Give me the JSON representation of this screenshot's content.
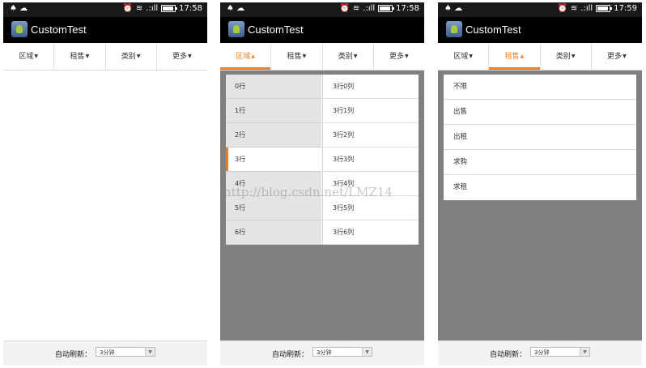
{
  "app": {
    "title": "CustomTest"
  },
  "status": {
    "times": [
      "17:58",
      "17:58",
      "17:59"
    ],
    "left_icons": "♠ ☁",
    "signal": ".:ıll"
  },
  "tabs": [
    {
      "label": "区域"
    },
    {
      "label": "租售"
    },
    {
      "label": "类别"
    },
    {
      "label": "更多"
    }
  ],
  "bottom": {
    "refresh_label": "自动刷新：",
    "refresh_value": "3分钟"
  },
  "panel2": {
    "left_rows": [
      "0行",
      "1行",
      "2行",
      "3行",
      "4行",
      "5行",
      "6行"
    ],
    "right_rows": [
      "3行0列",
      "3行1列",
      "3行2列",
      "3行3列",
      "3行4列",
      "3行5列",
      "3行6列"
    ],
    "selected_index": 3
  },
  "panel3": {
    "options": [
      "不限",
      "出售",
      "出租",
      "求购",
      "求租"
    ]
  },
  "watermark": "http://blog.csdn.net/LMZ14",
  "colors": {
    "accent": "#ef7d24",
    "overlay": "#808080",
    "actionbar": "#000000"
  }
}
